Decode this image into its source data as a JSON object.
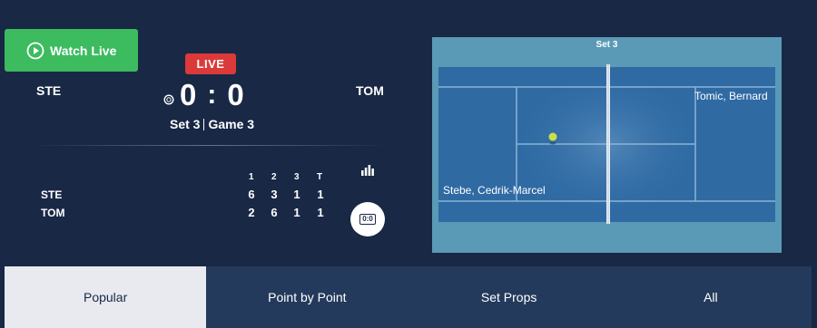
{
  "header": {
    "watch_label": "Watch Live",
    "live_label": "LIVE"
  },
  "match": {
    "team_home": "STE",
    "team_away": "TOM",
    "score_home": "0",
    "score_sep": ":",
    "score_away": "0",
    "set_label": "Set 3",
    "game_label": "Game 3"
  },
  "scoreboard": {
    "columns": [
      "1",
      "2",
      "3",
      "T"
    ],
    "rows": [
      {
        "team": "STE",
        "values": [
          "6",
          "3",
          "1",
          "1"
        ]
      },
      {
        "team": "TOM",
        "values": [
          "2",
          "6",
          "1",
          "1"
        ]
      }
    ],
    "toggle_label": "0:0"
  },
  "court": {
    "title": "Set 3",
    "player_top_right": "Tomic, Bernard",
    "player_bottom_left": "Stebe, Cedrik-Marcel",
    "ball_color": "#c8e04a"
  },
  "tabs": [
    {
      "label": "Popular",
      "active": true
    },
    {
      "label": "Point by Point",
      "active": false
    },
    {
      "label": "Set Props",
      "active": false
    },
    {
      "label": "All",
      "active": false
    }
  ],
  "colors": {
    "background": "#182845",
    "watch_button": "#3dbb5f",
    "live_badge": "#dc3a3a",
    "court_outer": "#5a9ab6",
    "court_inner": "#2f6aa3",
    "tab_bar": "#243a5c",
    "tab_active": "#e8eaf0"
  },
  "icons": [
    "play-icon",
    "tennis-ball-icon",
    "stats-bars-icon",
    "scoreboard-icon"
  ]
}
